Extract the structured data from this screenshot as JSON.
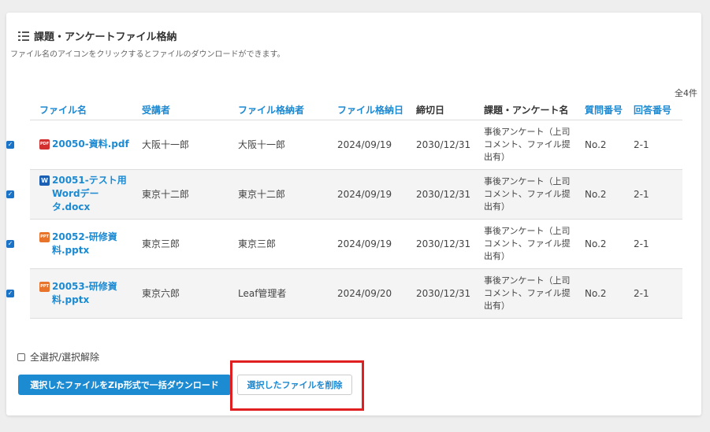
{
  "card": {
    "title": "課題・アンケートファイル格納",
    "title_icon": "list-icon",
    "description": "ファイル名のアイコンをクリックするとファイルのダウンロードができます。",
    "total": "全4件"
  },
  "table": {
    "headers": {
      "file": "ファイル名",
      "student": "受講者",
      "uploader": "ファイル格納者",
      "upload_date": "ファイル格納日",
      "deadline": "締切日",
      "assignment": "課題・アンケート名",
      "question_no": "質問番号",
      "answer_no": "回答番号"
    },
    "rows": [
      {
        "checked": true,
        "icon": "pdf-icon",
        "icon_text": "PDF",
        "file": "20050-資料.pdf",
        "student": "大阪十一郎",
        "uploader": "大阪十一郎",
        "upload_date": "2024/09/19",
        "deadline": "2030/12/31",
        "assignment": "事後アンケート（上司コメント、ファイル提出有）",
        "question_no": "No.2",
        "answer_no": "2-1"
      },
      {
        "checked": true,
        "icon": "word-icon",
        "icon_text": "W",
        "file": "20051-テスト用Wordデータ.docx",
        "student": "東京十二郎",
        "uploader": "東京十二郎",
        "upload_date": "2024/09/19",
        "deadline": "2030/12/31",
        "assignment": "事後アンケート（上司コメント、ファイル提出有）",
        "question_no": "No.2",
        "answer_no": "2-1"
      },
      {
        "checked": true,
        "icon": "powerpoint-icon",
        "icon_text": "PPT",
        "file": "20052-研修資料.pptx",
        "student": "東京三郎",
        "uploader": "東京三郎",
        "upload_date": "2024/09/19",
        "deadline": "2030/12/31",
        "assignment": "事後アンケート（上司コメント、ファイル提出有）",
        "question_no": "No.2",
        "answer_no": "2-1"
      },
      {
        "checked": true,
        "icon": "powerpoint-icon",
        "icon_text": "PPT",
        "file": "20053-研修資料.pptx",
        "student": "東京六郎",
        "uploader": "Leaf管理者",
        "upload_date": "2024/09/20",
        "deadline": "2030/12/31",
        "assignment": "事後アンケート（上司コメント、ファイル提出有）",
        "question_no": "No.2",
        "answer_no": "2-1"
      }
    ]
  },
  "actions": {
    "select_all_label": "全選択/選択解除",
    "select_all_checked": false,
    "zip_download_label": "選択したファイルをZip形式で一括ダウンロード",
    "delete_label": "選択したファイルを削除"
  },
  "colors": {
    "accent": "#1c8ad2",
    "highlight": "#e02020"
  }
}
